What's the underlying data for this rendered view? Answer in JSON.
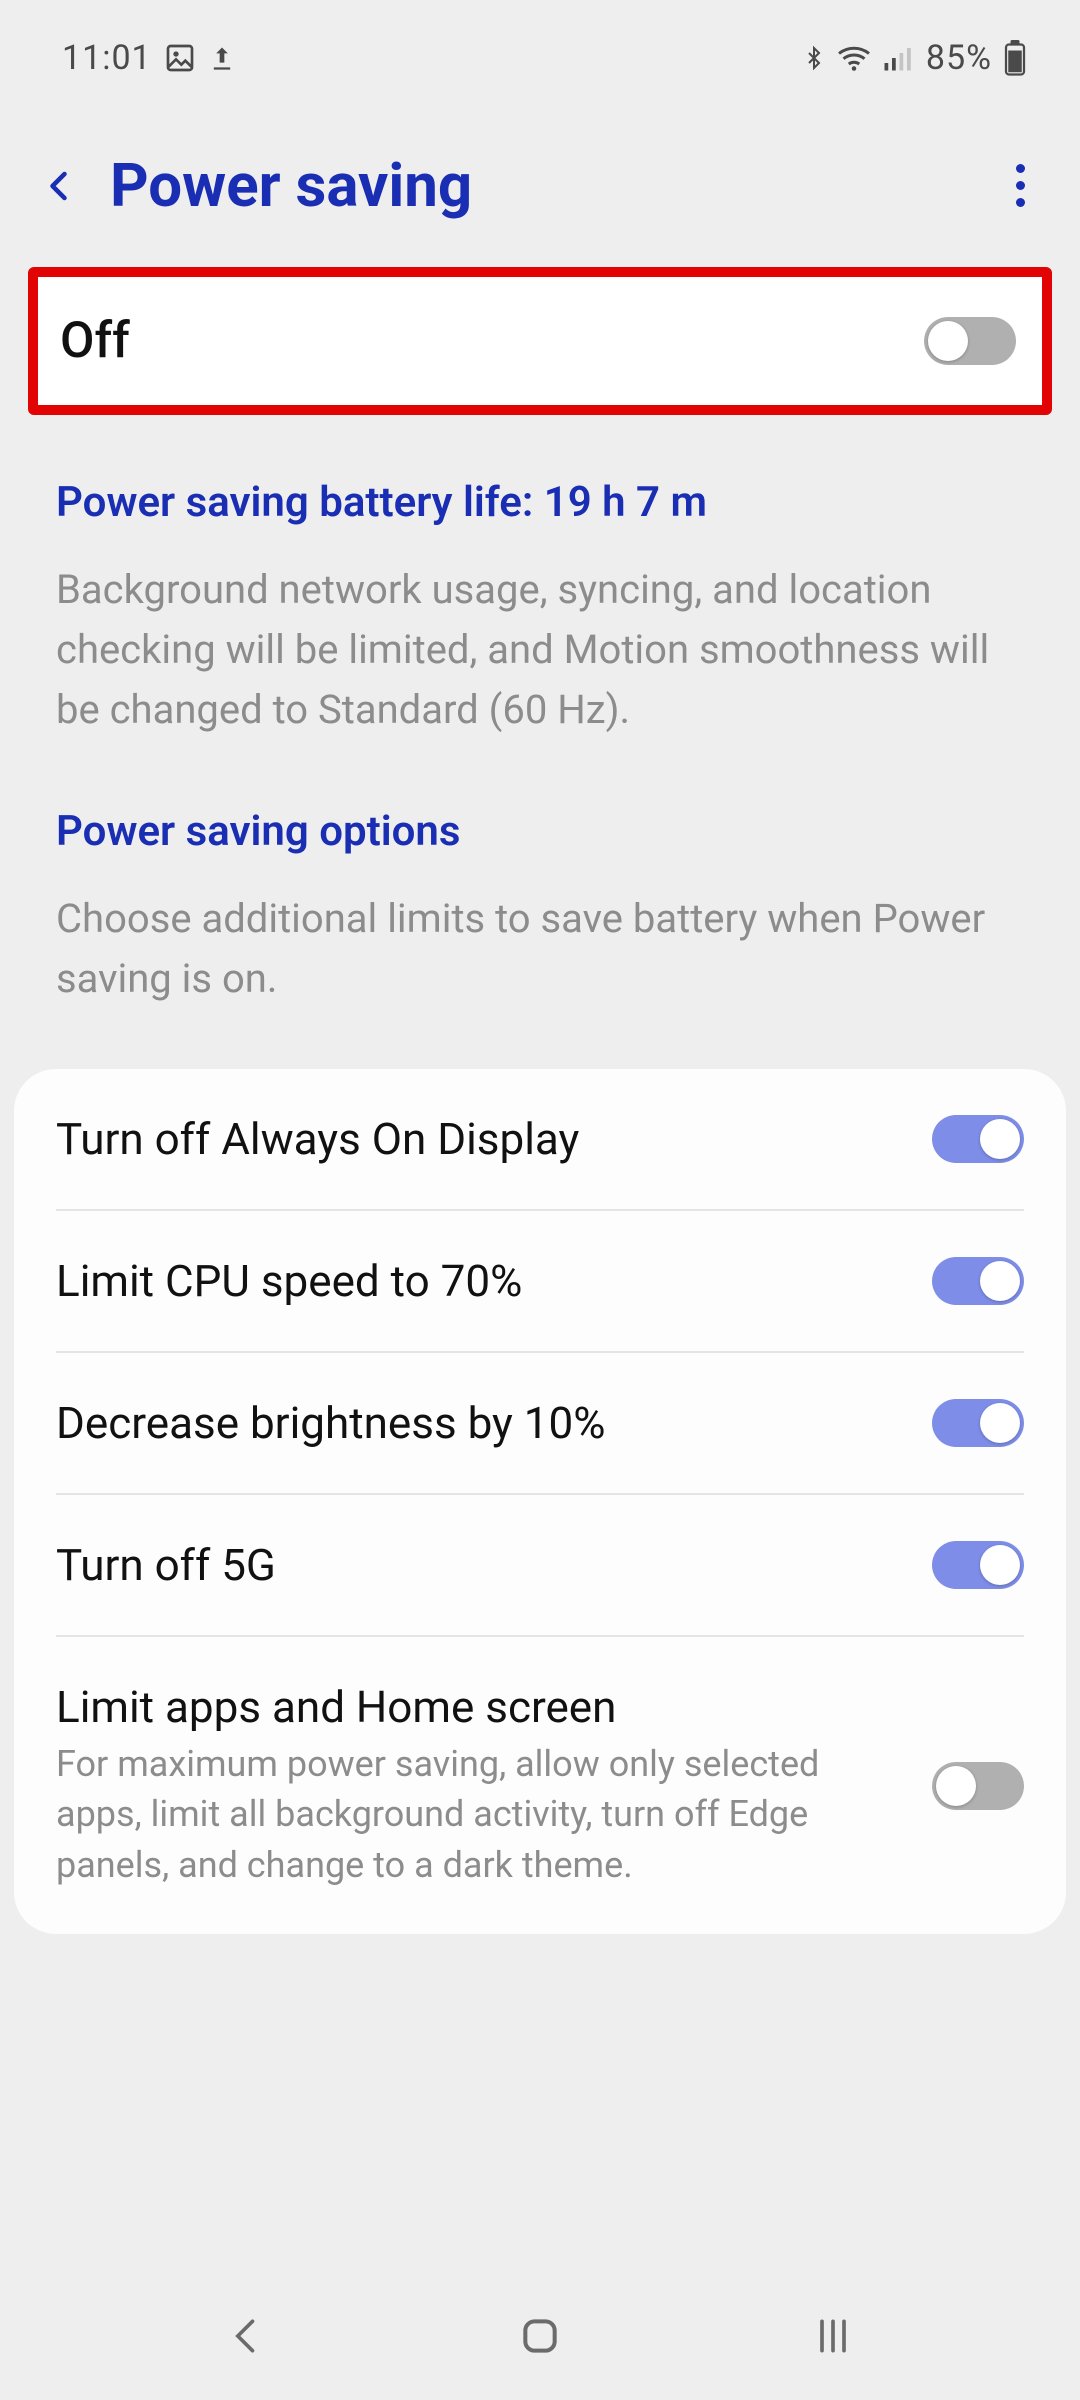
{
  "status": {
    "time": "11:01",
    "battery_percent": "85%"
  },
  "header": {
    "title": "Power saving"
  },
  "main_toggle": {
    "label": "Off",
    "state": "off"
  },
  "battery_life": {
    "heading": "Power saving battery life: 19 h 7 m",
    "description": "Background network usage, syncing, and location checking will be limited, and Motion smoothness will be changed to Standard (60 Hz)."
  },
  "options_intro": {
    "heading": "Power saving options",
    "description": "Choose additional limits to save battery when Power saving is on."
  },
  "options": [
    {
      "title": "Turn off Always On Display",
      "sub": "",
      "state": "on"
    },
    {
      "title": "Limit CPU speed to 70%",
      "sub": "",
      "state": "on"
    },
    {
      "title": "Decrease brightness by 10%",
      "sub": "",
      "state": "on"
    },
    {
      "title": "Turn off 5G",
      "sub": "",
      "state": "on"
    },
    {
      "title": "Limit apps and Home screen",
      "sub": "For maximum power saving, allow only selected apps, limit all background activity, turn off Edge panels, and change to a dark theme.",
      "state": "off"
    }
  ]
}
